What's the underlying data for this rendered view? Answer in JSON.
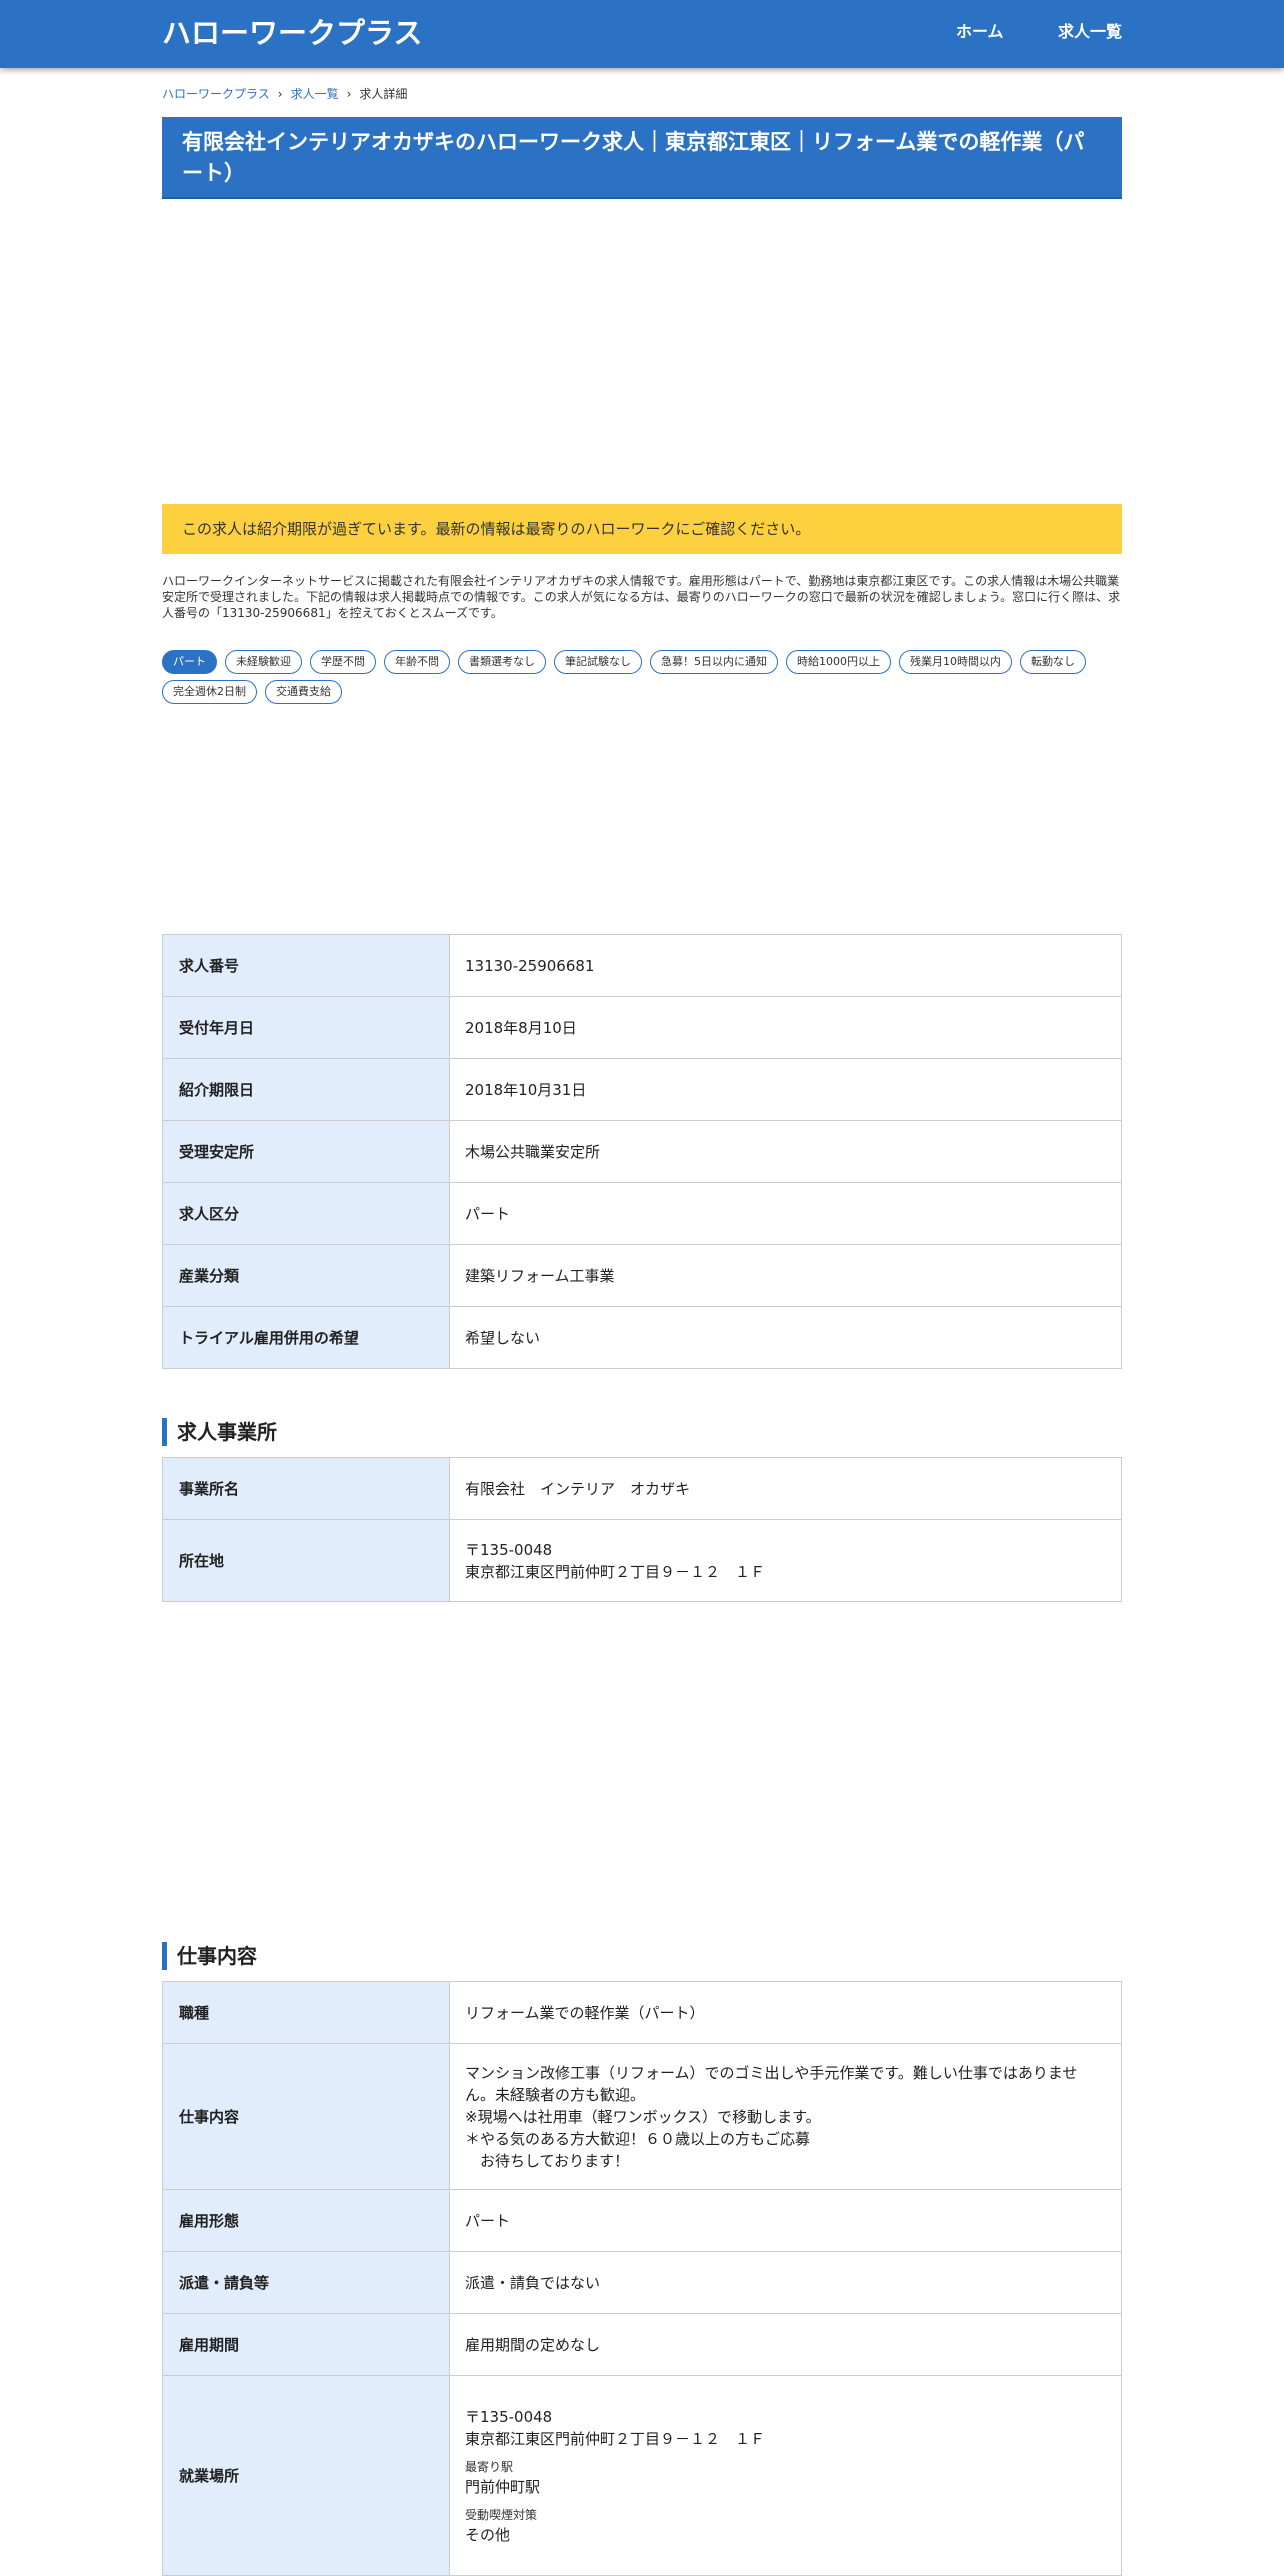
{
  "header": {
    "brand": "ハローワークプラス",
    "nav": [
      {
        "label": "ホーム"
      },
      {
        "label": "求人一覧"
      }
    ]
  },
  "breadcrumb": {
    "items": [
      "ハローワークプラス",
      "求人一覧",
      "求人詳細"
    ]
  },
  "page_title": "有限会社インテリアオカザキのハローワーク求人｜東京都江東区｜リフォーム業での軽作業（パート）",
  "notice": "この求人は紹介期限が過ぎています。最新の情報は最寄りのハローワークにご確認ください。",
  "description": "ハローワークインターネットサービスに掲載された有限会社インテリアオカザキの求人情報です。雇用形態はパートで、勤務地は東京都江東区です。この求人情報は木場公共職業安定所で受理されました。下記の情報は求人掲載時点での情報です。この求人が気になる方は、最寄りのハローワークの窓口で最新の状況を確認しましょう。窓口に行く際は、求人番号の「13130-25906681」を控えておくとスムーズです。",
  "tags": [
    "パート",
    "未経験歓迎",
    "学歴不問",
    "年齢不問",
    "書類選考なし",
    "筆記試験なし",
    "急募！5日以内に通知",
    "時給1000円以上",
    "残業月10時間以内",
    "転勤なし",
    "完全週休2日制",
    "交通費支給"
  ],
  "summary": {
    "rows": [
      {
        "label": "求人番号",
        "value": "13130-25906681"
      },
      {
        "label": "受付年月日",
        "value": "2018年8月10日"
      },
      {
        "label": "紹介期限日",
        "value": "2018年10月31日"
      },
      {
        "label": "受理安定所",
        "value": "木場公共職業安定所"
      },
      {
        "label": "求人区分",
        "value": "パート"
      },
      {
        "label": "産業分類",
        "value": "建築リフォーム工事業"
      },
      {
        "label": "トライアル雇用併用の希望",
        "value": "希望しない"
      }
    ]
  },
  "office": {
    "heading": "求人事業所",
    "name_label": "事業所名",
    "name_value": "有限会社　インテリア　オカザキ",
    "address_label": "所在地",
    "postal": "〒135-0048",
    "address": "東京都江東区門前仲町２丁目９－１２　１Ｆ"
  },
  "job": {
    "heading": "仕事内容",
    "title_label": "職種",
    "title_value": "リフォーム業での軽作業（パート）",
    "content_label": "仕事内容",
    "content_value": "マンション改修工事（リフォーム）でのゴミ出しや手元作業です。難しい仕事ではありません。未経験者の方も歓迎。\n※現場へは社用車（軽ワンボックス）で移動します。\n＊やる気のある方大歓迎！６０歳以上の方もご応募\n　お待ちしております！",
    "employment_label": "雇用形態",
    "employment_value": "パート",
    "dispatch_label": "派遣・請負等",
    "dispatch_value": "派遣・請負ではない",
    "period_label": "雇用期間",
    "period_value": "雇用期間の定めなし",
    "workplace_label": "就業場所",
    "workplace_postal": "〒135-0048",
    "workplace_address": "東京都江東区門前仲町２丁目９－１２　１Ｆ",
    "station_label": "最寄り駅",
    "station_value": "門前仲町駅",
    "smoking_label": "受動喫煙対策",
    "smoking_value": "その他"
  }
}
